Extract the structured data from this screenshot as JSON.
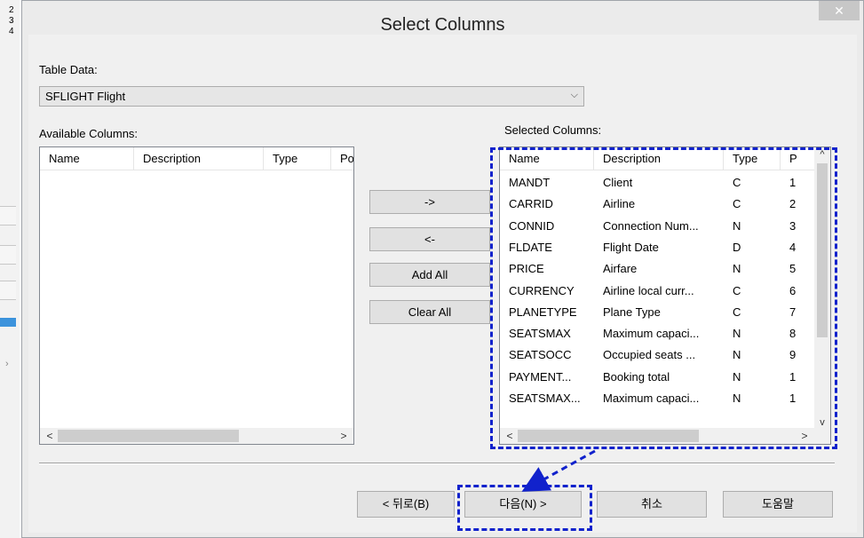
{
  "background": {
    "numbers": [
      "2",
      "3",
      "4"
    ]
  },
  "dialog": {
    "title": "Select Columns",
    "close_label": "✕",
    "table_data_label": "Table Data:",
    "table_select_value": "SFLIGHT Flight",
    "available_label": "Available Columns:",
    "selected_label": "Selected Columns:",
    "available_headers": [
      "Name",
      "Description",
      "Type",
      "Po"
    ],
    "selected_headers": [
      "Name",
      "Description",
      "Type",
      "P"
    ],
    "selected_rows": [
      {
        "name": "MANDT",
        "description": "Client",
        "type": "C",
        "pos": "1"
      },
      {
        "name": "CARRID",
        "description": "Airline",
        "type": "C",
        "pos": "2"
      },
      {
        "name": "CONNID",
        "description": "Connection Num...",
        "type": "N",
        "pos": "3"
      },
      {
        "name": "FLDATE",
        "description": "Flight Date",
        "type": "D",
        "pos": "4"
      },
      {
        "name": "PRICE",
        "description": "Airfare",
        "type": "N",
        "pos": "5"
      },
      {
        "name": "CURRENCY",
        "description": "Airline local curr...",
        "type": "C",
        "pos": "6"
      },
      {
        "name": "PLANETYPE",
        "description": "Plane Type",
        "type": "C",
        "pos": "7"
      },
      {
        "name": "SEATSMAX",
        "description": "Maximum capaci...",
        "type": "N",
        "pos": "8"
      },
      {
        "name": "SEATSOCC",
        "description": "Occupied seats ...",
        "type": "N",
        "pos": "9"
      },
      {
        "name": "PAYMENT...",
        "description": "Booking total",
        "type": "N",
        "pos": "1"
      },
      {
        "name": "SEATSMAX...",
        "description": "Maximum capaci...",
        "type": "N",
        "pos": "1"
      }
    ],
    "buttons": {
      "add": "->",
      "remove": "<-",
      "add_all": "Add All",
      "clear_all": "Clear All",
      "back": "< 뒤로(B)",
      "next": "다음(N) >",
      "cancel": "취소",
      "help": "도움말"
    },
    "scroll_arrows": {
      "left": "<",
      "right": ">",
      "up": "^",
      "down": "v"
    }
  },
  "colors": {
    "annotation": "#1122cc",
    "dialog_bg": "#f0f0f0"
  }
}
